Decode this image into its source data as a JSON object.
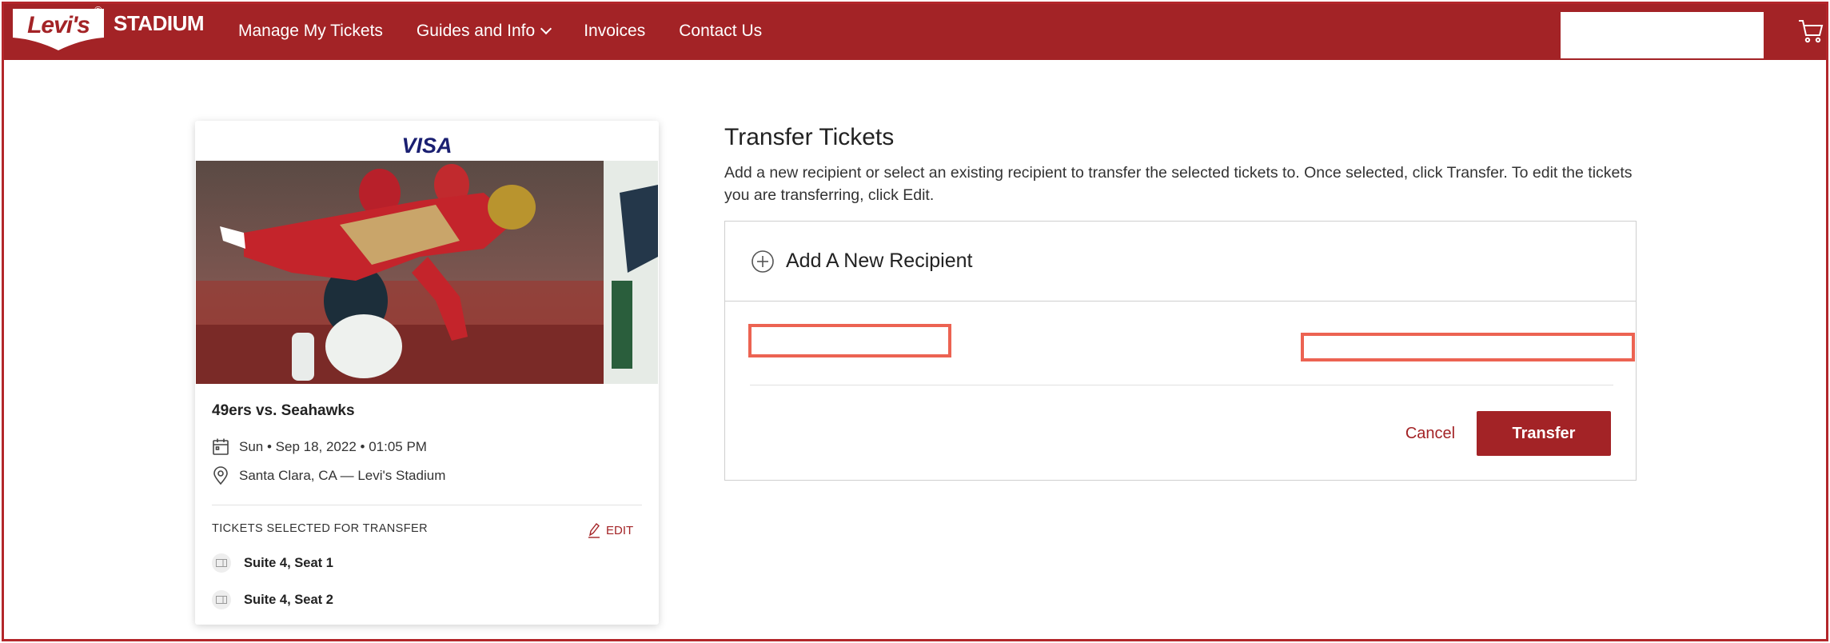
{
  "header": {
    "logo_brand": "Levi's",
    "logo_reg": "®",
    "logo_stadium": "STADIUM",
    "nav": [
      {
        "label": "Manage My Tickets"
      },
      {
        "label": "Guides and Info"
      },
      {
        "label": "Invoices"
      },
      {
        "label": "Contact Us"
      }
    ]
  },
  "event_card": {
    "sponsor": "VISA",
    "title": "49ers vs. Seahawks",
    "datetime": "Sun • Sep 18, 2022 • 01:05 PM",
    "location": "Santa Clara, CA — Levi's Stadium",
    "selected_heading": "TICKETS SELECTED FOR TRANSFER",
    "edit_label": "EDIT",
    "tickets": [
      {
        "label": "Suite 4, Seat 1"
      },
      {
        "label": "Suite 4, Seat 2"
      }
    ]
  },
  "transfer": {
    "title": "Transfer Tickets",
    "description": "Add a new recipient or select an existing recipient to transfer the selected tickets to. Once selected, click Transfer. To edit the tickets you are transferring, click Edit.",
    "add_recipient_label": "Add A New Recipient",
    "cancel_label": "Cancel",
    "transfer_label": "Transfer"
  },
  "colors": {
    "brand": "#a32326",
    "redaction": "#ec6352",
    "visa": "#1a1f71"
  }
}
